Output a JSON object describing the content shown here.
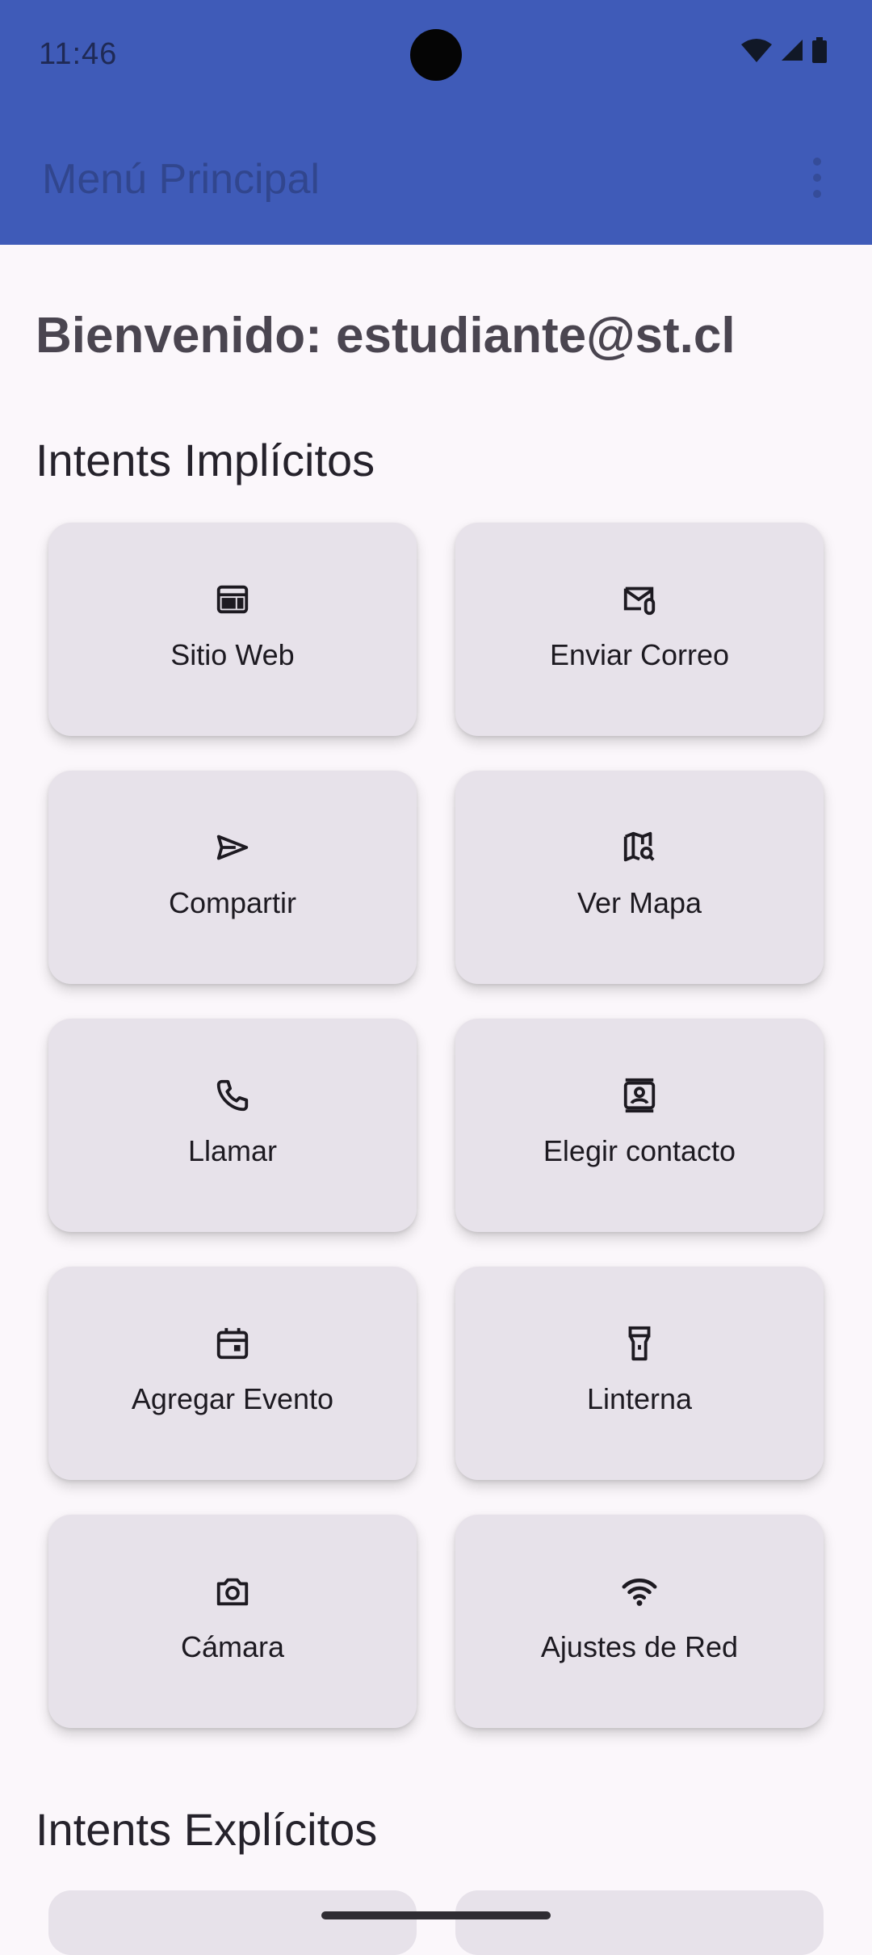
{
  "status_bar": {
    "time": "11:46",
    "icons": [
      "wifi-icon",
      "cellular-signal-icon",
      "battery-icon"
    ]
  },
  "app_bar": {
    "title": "Menú Principal",
    "overflow_icon": "more-vert-icon"
  },
  "welcome": "Bienvenido: estudiante@st.cl",
  "sections": {
    "implicit_title": "Intents Implícitos",
    "explicit_title": "Intents Explícitos"
  },
  "implicit_actions": [
    {
      "label": "Sitio Web",
      "icon": "web-icon"
    },
    {
      "label": "Enviar Correo",
      "icon": "mail-icon"
    },
    {
      "label": "Compartir",
      "icon": "send-icon"
    },
    {
      "label": "Ver Mapa",
      "icon": "map-search-icon"
    },
    {
      "label": "Llamar",
      "icon": "phone-icon"
    },
    {
      "label": "Elegir contacto",
      "icon": "contact-icon"
    },
    {
      "label": "Agregar Evento",
      "icon": "calendar-icon"
    },
    {
      "label": "Linterna",
      "icon": "flashlight-icon"
    },
    {
      "label": "Cámara",
      "icon": "camera-icon"
    },
    {
      "label": "Ajustes de Red",
      "icon": "wifi-icon"
    }
  ],
  "colors": {
    "app_bar": "#3f5bb8",
    "background": "#fbf7fb",
    "card": "#e7e2ea",
    "text": "#1d1a21"
  }
}
